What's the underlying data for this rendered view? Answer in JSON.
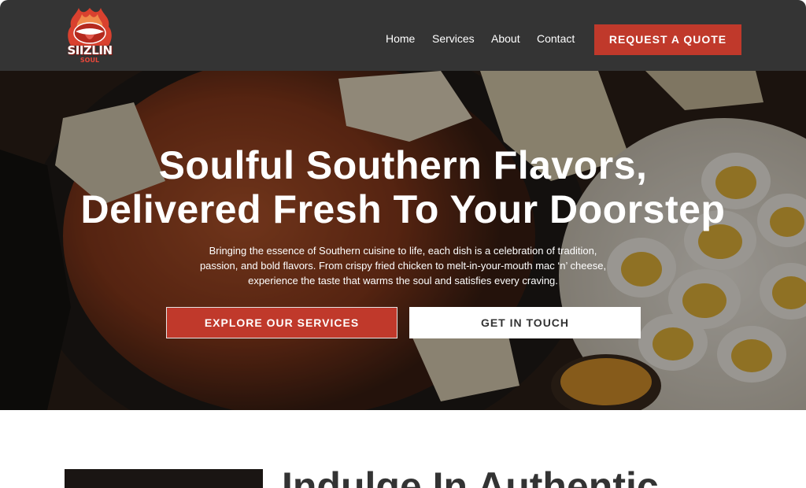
{
  "brand": {
    "logo_text": "SIIZLIN",
    "logo_sub": "SOUL"
  },
  "nav": {
    "items": [
      "Home",
      "Services",
      "About",
      "Contact"
    ],
    "cta": "REQUEST A QUOTE"
  },
  "hero": {
    "title_line1": "Soulful Southern Flavors,",
    "title_line2": "Delivered Fresh To Your Doorstep",
    "text_line1": "Bringing the essence of Southern cuisine to life, each dish is a celebration of tradition,",
    "text_line2": "passion, and bold flavors. From crispy fried chicken to melt-in-your-mouth mac ‘n’ cheese,",
    "text_line3": "experience the taste that warms the soul and satisfies every craving.",
    "primary_button": "EXPLORE OUR SERVICES",
    "secondary_button": "GET IN TOUCH"
  },
  "section": {
    "title": "Indulge In Authentic"
  },
  "colors": {
    "header_bg": "#343434",
    "accent": "#c0392b"
  }
}
